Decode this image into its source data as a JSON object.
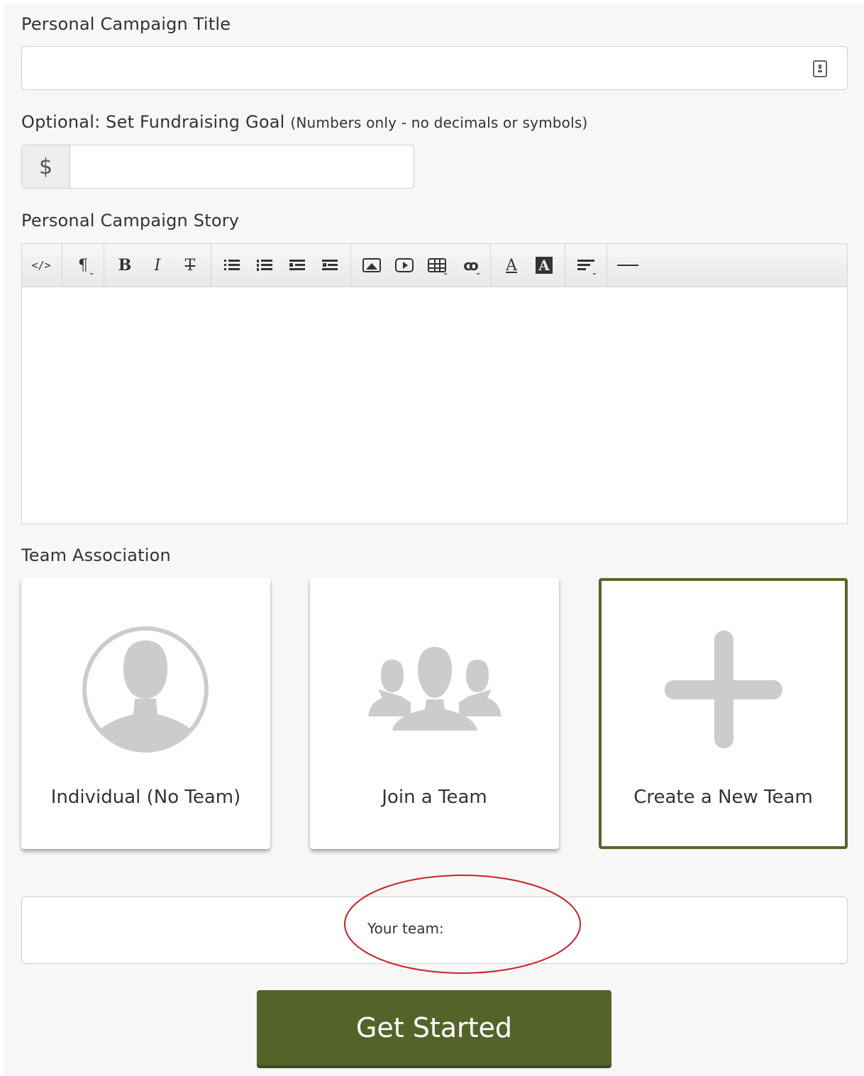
{
  "form": {
    "title_label": "Personal Campaign Title",
    "title_value": "",
    "goal_label": "Optional: Set Fundraising Goal",
    "goal_hint": "(Numbers only - no decimals or symbols)",
    "goal_currency": "$",
    "goal_value": "",
    "story_label": "Personal Campaign Story",
    "story_value": ""
  },
  "editor_toolbar": {
    "code_view": "</>",
    "paragraph": "¶",
    "bold": "B",
    "italic": "I",
    "strikethrough": "T",
    "font_color": "A",
    "background_color": "A"
  },
  "team": {
    "label": "Team Association",
    "options": [
      {
        "label": "Individual (No Team)",
        "icon": "person-circle-icon",
        "selected": false
      },
      {
        "label": "Join a Team",
        "icon": "group-icon",
        "selected": false
      },
      {
        "label": "Create a New Team",
        "icon": "plus-icon",
        "selected": true
      }
    ],
    "your_team_label": "Your team:"
  },
  "actions": {
    "submit_label": "Get Started"
  },
  "colors": {
    "brand_green": "#56662a",
    "annotation_red": "#c8202c"
  }
}
